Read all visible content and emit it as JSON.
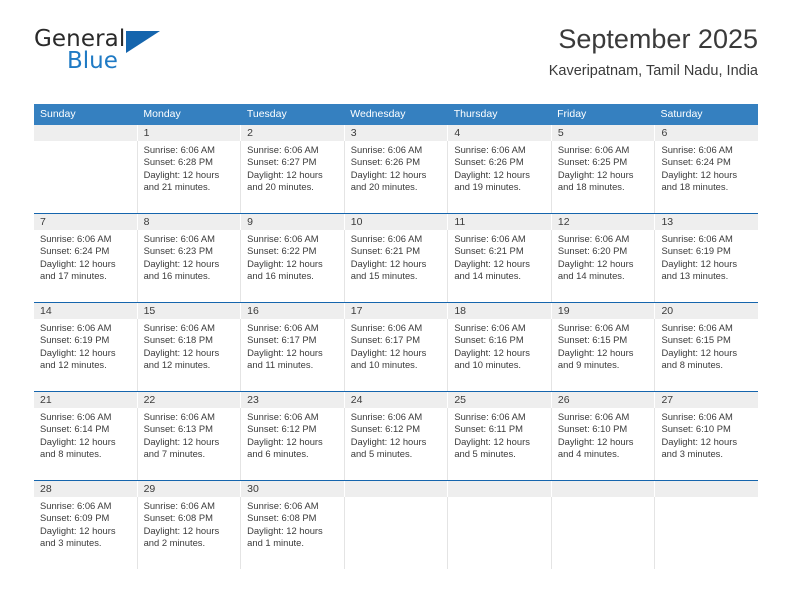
{
  "brand": {
    "name_top": "General",
    "name_bottom": "Blue",
    "accent_color": "#1f7ac4",
    "triangle_color": "#1565ad"
  },
  "header": {
    "title": "September 2025",
    "subtitle": "Kaveripatnam, Tamil Nadu, India"
  },
  "colors": {
    "header_row_bg": "#3580c0",
    "header_row_text": "#ffffff",
    "daynum_band_bg": "#eeeeee",
    "week_divider": "#1565ad",
    "body_text": "#3b3b3b"
  },
  "weekdays": [
    "Sunday",
    "Monday",
    "Tuesday",
    "Wednesday",
    "Thursday",
    "Friday",
    "Saturday"
  ],
  "weeks": [
    [
      {
        "day": "",
        "lines": []
      },
      {
        "day": "1",
        "lines": [
          "Sunrise: 6:06 AM",
          "Sunset: 6:28 PM",
          "Daylight: 12 hours",
          "and 21 minutes."
        ]
      },
      {
        "day": "2",
        "lines": [
          "Sunrise: 6:06 AM",
          "Sunset: 6:27 PM",
          "Daylight: 12 hours",
          "and 20 minutes."
        ]
      },
      {
        "day": "3",
        "lines": [
          "Sunrise: 6:06 AM",
          "Sunset: 6:26 PM",
          "Daylight: 12 hours",
          "and 20 minutes."
        ]
      },
      {
        "day": "4",
        "lines": [
          "Sunrise: 6:06 AM",
          "Sunset: 6:26 PM",
          "Daylight: 12 hours",
          "and 19 minutes."
        ]
      },
      {
        "day": "5",
        "lines": [
          "Sunrise: 6:06 AM",
          "Sunset: 6:25 PM",
          "Daylight: 12 hours",
          "and 18 minutes."
        ]
      },
      {
        "day": "6",
        "lines": [
          "Sunrise: 6:06 AM",
          "Sunset: 6:24 PM",
          "Daylight: 12 hours",
          "and 18 minutes."
        ]
      }
    ],
    [
      {
        "day": "7",
        "lines": [
          "Sunrise: 6:06 AM",
          "Sunset: 6:24 PM",
          "Daylight: 12 hours",
          "and 17 minutes."
        ]
      },
      {
        "day": "8",
        "lines": [
          "Sunrise: 6:06 AM",
          "Sunset: 6:23 PM",
          "Daylight: 12 hours",
          "and 16 minutes."
        ]
      },
      {
        "day": "9",
        "lines": [
          "Sunrise: 6:06 AM",
          "Sunset: 6:22 PM",
          "Daylight: 12 hours",
          "and 16 minutes."
        ]
      },
      {
        "day": "10",
        "lines": [
          "Sunrise: 6:06 AM",
          "Sunset: 6:21 PM",
          "Daylight: 12 hours",
          "and 15 minutes."
        ]
      },
      {
        "day": "11",
        "lines": [
          "Sunrise: 6:06 AM",
          "Sunset: 6:21 PM",
          "Daylight: 12 hours",
          "and 14 minutes."
        ]
      },
      {
        "day": "12",
        "lines": [
          "Sunrise: 6:06 AM",
          "Sunset: 6:20 PM",
          "Daylight: 12 hours",
          "and 14 minutes."
        ]
      },
      {
        "day": "13",
        "lines": [
          "Sunrise: 6:06 AM",
          "Sunset: 6:19 PM",
          "Daylight: 12 hours",
          "and 13 minutes."
        ]
      }
    ],
    [
      {
        "day": "14",
        "lines": [
          "Sunrise: 6:06 AM",
          "Sunset: 6:19 PM",
          "Daylight: 12 hours",
          "and 12 minutes."
        ]
      },
      {
        "day": "15",
        "lines": [
          "Sunrise: 6:06 AM",
          "Sunset: 6:18 PM",
          "Daylight: 12 hours",
          "and 12 minutes."
        ]
      },
      {
        "day": "16",
        "lines": [
          "Sunrise: 6:06 AM",
          "Sunset: 6:17 PM",
          "Daylight: 12 hours",
          "and 11 minutes."
        ]
      },
      {
        "day": "17",
        "lines": [
          "Sunrise: 6:06 AM",
          "Sunset: 6:17 PM",
          "Daylight: 12 hours",
          "and 10 minutes."
        ]
      },
      {
        "day": "18",
        "lines": [
          "Sunrise: 6:06 AM",
          "Sunset: 6:16 PM",
          "Daylight: 12 hours",
          "and 10 minutes."
        ]
      },
      {
        "day": "19",
        "lines": [
          "Sunrise: 6:06 AM",
          "Sunset: 6:15 PM",
          "Daylight: 12 hours",
          "and 9 minutes."
        ]
      },
      {
        "day": "20",
        "lines": [
          "Sunrise: 6:06 AM",
          "Sunset: 6:15 PM",
          "Daylight: 12 hours",
          "and 8 minutes."
        ]
      }
    ],
    [
      {
        "day": "21",
        "lines": [
          "Sunrise: 6:06 AM",
          "Sunset: 6:14 PM",
          "Daylight: 12 hours",
          "and 8 minutes."
        ]
      },
      {
        "day": "22",
        "lines": [
          "Sunrise: 6:06 AM",
          "Sunset: 6:13 PM",
          "Daylight: 12 hours",
          "and 7 minutes."
        ]
      },
      {
        "day": "23",
        "lines": [
          "Sunrise: 6:06 AM",
          "Sunset: 6:12 PM",
          "Daylight: 12 hours",
          "and 6 minutes."
        ]
      },
      {
        "day": "24",
        "lines": [
          "Sunrise: 6:06 AM",
          "Sunset: 6:12 PM",
          "Daylight: 12 hours",
          "and 5 minutes."
        ]
      },
      {
        "day": "25",
        "lines": [
          "Sunrise: 6:06 AM",
          "Sunset: 6:11 PM",
          "Daylight: 12 hours",
          "and 5 minutes."
        ]
      },
      {
        "day": "26",
        "lines": [
          "Sunrise: 6:06 AM",
          "Sunset: 6:10 PM",
          "Daylight: 12 hours",
          "and 4 minutes."
        ]
      },
      {
        "day": "27",
        "lines": [
          "Sunrise: 6:06 AM",
          "Sunset: 6:10 PM",
          "Daylight: 12 hours",
          "and 3 minutes."
        ]
      }
    ],
    [
      {
        "day": "28",
        "lines": [
          "Sunrise: 6:06 AM",
          "Sunset: 6:09 PM",
          "Daylight: 12 hours",
          "and 3 minutes."
        ]
      },
      {
        "day": "29",
        "lines": [
          "Sunrise: 6:06 AM",
          "Sunset: 6:08 PM",
          "Daylight: 12 hours",
          "and 2 minutes."
        ]
      },
      {
        "day": "30",
        "lines": [
          "Sunrise: 6:06 AM",
          "Sunset: 6:08 PM",
          "Daylight: 12 hours",
          "and 1 minute."
        ]
      },
      {
        "day": "",
        "lines": []
      },
      {
        "day": "",
        "lines": []
      },
      {
        "day": "",
        "lines": []
      },
      {
        "day": "",
        "lines": []
      }
    ]
  ]
}
